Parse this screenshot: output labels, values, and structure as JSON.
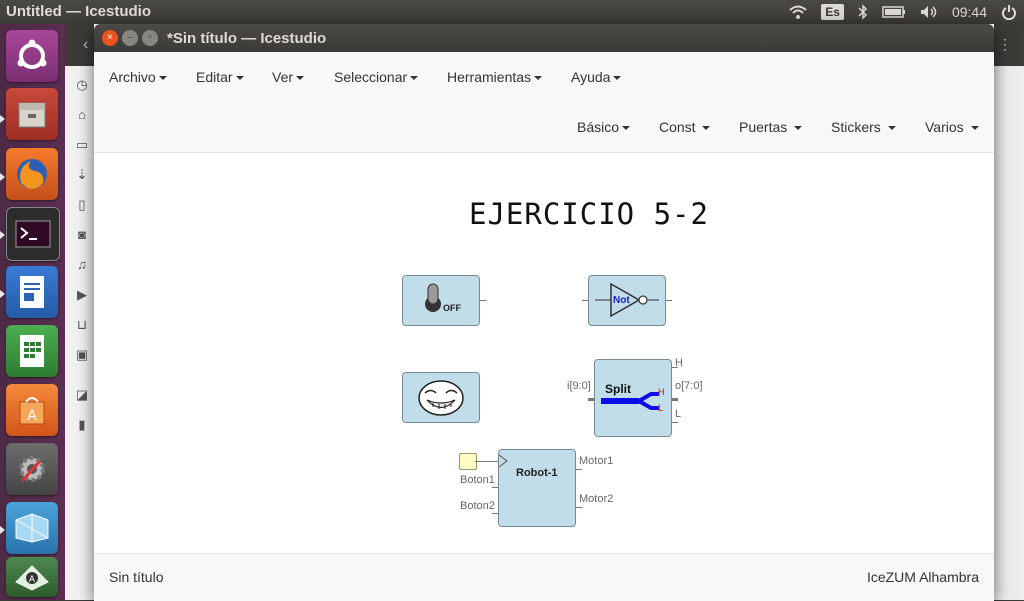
{
  "top_panel": {
    "app_title": "Untitled — Icestudio",
    "keyboard_layout": "Es",
    "clock": "09:44",
    "icons": [
      "wifi-icon",
      "keyboard-icon",
      "bluetooth-icon",
      "battery-icon",
      "volume-icon"
    ]
  },
  "launcher": {
    "items": [
      "ubuntu-dash",
      "file-archive",
      "firefox",
      "terminal",
      "libreoffice-writer",
      "libreoffice-calc",
      "software-center",
      "system-settings",
      "app-window",
      "icestudio"
    ]
  },
  "window": {
    "title": "*Sin título — Icestudio"
  },
  "menubar": {
    "items": [
      "Archivo",
      "Editar",
      "Ver",
      "Seleccionar",
      "Herramientas",
      "Ayuda"
    ]
  },
  "toolbar": {
    "items": [
      "Básico",
      "Const",
      "Puertas",
      "Stickers",
      "Varios"
    ]
  },
  "canvas": {
    "title": "EJERCICIO 5-2",
    "switch_label": "OFF",
    "not_label": "Not",
    "split": {
      "label": "Split",
      "input": "i[9:0]",
      "output": "o[7:0]",
      "h": "H",
      "l": "L",
      "inner_h": "H",
      "inner_l": "L"
    },
    "robot": {
      "label": "Robot-1",
      "inputs": [
        "Boton1",
        "Boton2"
      ],
      "outputs": [
        "Motor1",
        "Motor2"
      ]
    }
  },
  "statusbar": {
    "left": "Sin título",
    "right": "IceZUM Alhambra"
  }
}
